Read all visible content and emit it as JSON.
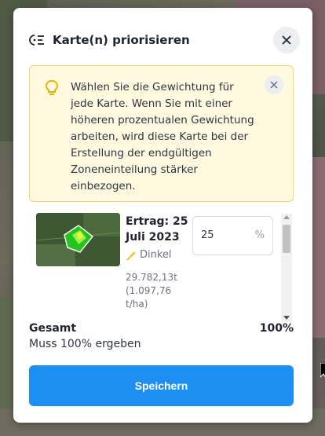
{
  "dialog": {
    "title": "Karte(n) priorisieren",
    "title_icon": "prioritize-list-icon",
    "close_icon": "close-icon"
  },
  "info": {
    "icon": "lightbulb-icon",
    "text": "Wählen Sie die Gewichtung für jede Karte. Wenn Sie mit einer höheren prozentualen Gewichtung arbeiten, wird diese Karte bei der Erstellung der endgültigen Zoneneinteilung stärker einbezogen.",
    "close_icon": "close-icon"
  },
  "maps": [
    {
      "title": "Ertrag: 25 Juli 2023",
      "crop_icon": "wheat-icon",
      "crop": "Dinkel",
      "yield": "29.782,13t (1.097,76 t/ha)",
      "weight": "25",
      "unit": "%"
    }
  ],
  "summary": {
    "total_label": "Gesamt",
    "total_value": "100%",
    "hint": "Muss 100% ergeben"
  },
  "actions": {
    "save_label": "Speichern"
  },
  "colors": {
    "accent": "#1d8ff2",
    "info_bg": "#fff9e0",
    "info_border": "#f1d46a",
    "bulb": "#e6b400"
  }
}
